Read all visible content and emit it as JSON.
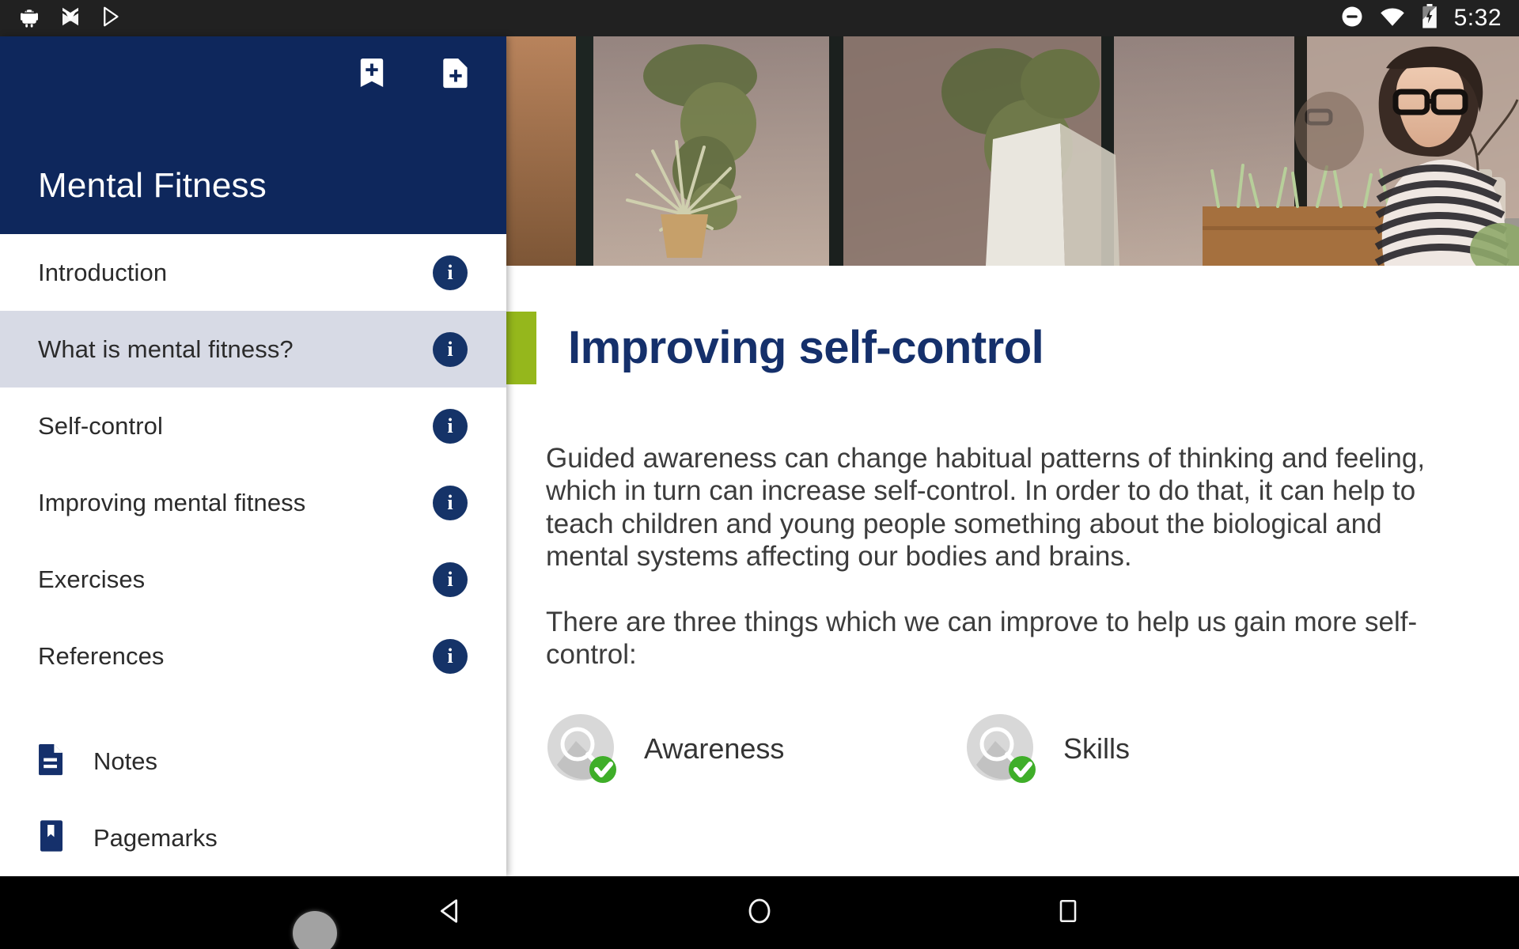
{
  "statusbar": {
    "time": "5:32",
    "icons_left": [
      "android-icon",
      "checkmark-app-icon",
      "play-store-icon"
    ],
    "icons_right": [
      "do-not-disturb-icon",
      "wifi-icon",
      "battery-charging-icon"
    ]
  },
  "drawer": {
    "title": "Mental Fitness",
    "header_color": "#0E275C",
    "actions": [
      {
        "name": "add-bookmark-button",
        "icon": "bookmark-add-icon"
      },
      {
        "name": "add-note-button",
        "icon": "note-add-icon"
      }
    ],
    "nav_items": [
      {
        "label": "Introduction",
        "selected": false,
        "badge": "i"
      },
      {
        "label": "What is mental fitness?",
        "selected": true,
        "badge": "i"
      },
      {
        "label": "Self-control",
        "selected": false,
        "badge": "i"
      },
      {
        "label": "Improving mental fitness",
        "selected": false,
        "badge": "i"
      },
      {
        "label": "Exercises",
        "selected": false,
        "badge": "i"
      },
      {
        "label": "References",
        "selected": false,
        "badge": "i"
      }
    ],
    "tools": [
      {
        "label": "Notes",
        "icon": "notes-document-icon"
      },
      {
        "label": "Pagemarks",
        "icon": "pagemark-bookmark-icon"
      }
    ],
    "selected_bg": "#D7DAE5",
    "badge_color": "#153368"
  },
  "content": {
    "hero_alt": "Woman with glasses in striped shirt working on a laptop by a window with plants",
    "accent_color": "#95B71C",
    "title": "Improving self-control",
    "title_color": "#15306B",
    "paragraphs": [
      "Guided awareness can change habitual patterns of thinking and feeling, which in turn can increase self-control. In order to do that, it can help to teach children and young people something about the biological and mental systems affecting our bodies and brains.",
      "There are three things which we can improve to help us gain more self-control:"
    ],
    "items": [
      {
        "label": "Awareness",
        "icon": "magnifier-circle-icon",
        "status": "complete",
        "status_color": "#3FAE29"
      },
      {
        "label": "Skills",
        "icon": "magnifier-circle-icon",
        "status": "complete",
        "status_color": "#3FAE29"
      }
    ]
  },
  "navbar": {
    "buttons": [
      {
        "name": "back-button",
        "icon": "triangle-back-icon"
      },
      {
        "name": "home-button",
        "icon": "circle-home-icon"
      },
      {
        "name": "recents-button",
        "icon": "square-recents-icon"
      }
    ]
  }
}
